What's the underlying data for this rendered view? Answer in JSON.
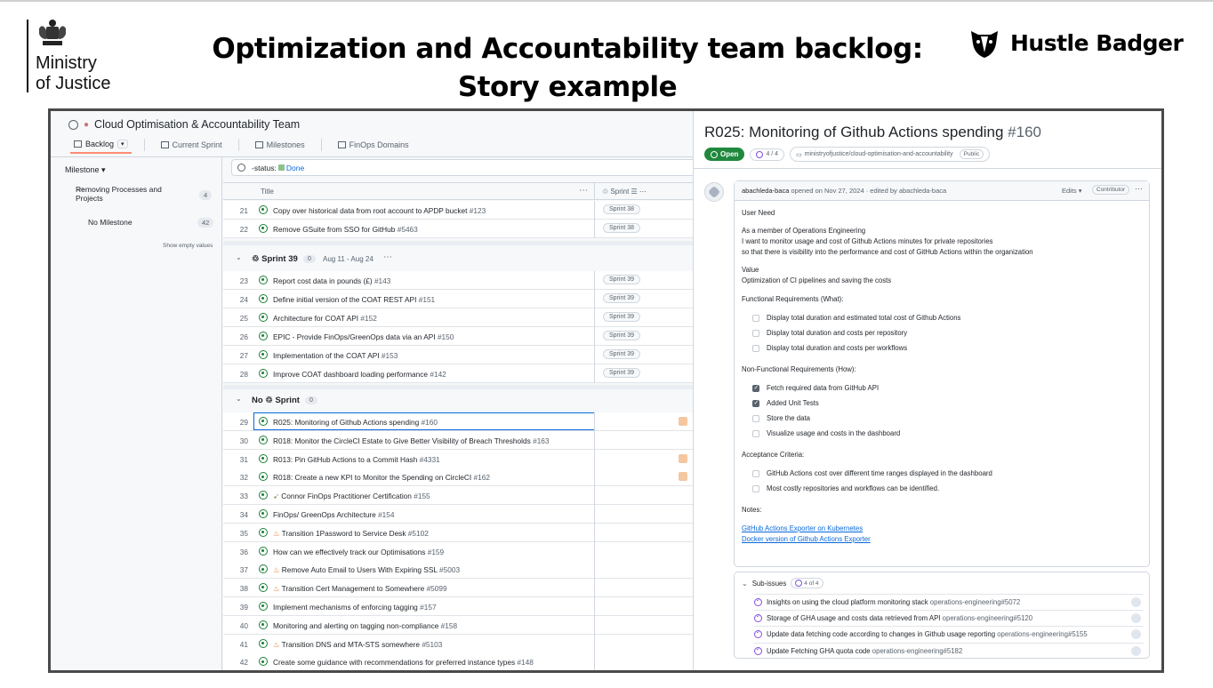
{
  "slide": {
    "title_line1": "Optimization and Accountability team backlog:",
    "title_line2": "Story example",
    "moj_line1": "Ministry",
    "moj_line2": "of Justice",
    "brand": "Hustle Badger"
  },
  "project": {
    "title": "Cloud Optimisation & Accountability Team",
    "tabs": [
      {
        "label": "Backlog",
        "active": true
      },
      {
        "label": "Current Sprint"
      },
      {
        "label": "Milestones"
      },
      {
        "label": "FinOps Domains"
      }
    ],
    "sidebar": {
      "header": "Milestone",
      "items": [
        {
          "label_line1": "Removing Processes and",
          "label_line2": "Projects",
          "count": "4"
        },
        {
          "label_line1": "No Milestone",
          "label_line2": "",
          "count": "42"
        }
      ],
      "show_empty": "Show empty values"
    },
    "filter": {
      "prefix": "-status:",
      "value": "Done"
    },
    "columns": {
      "title": "Title",
      "sprint": "Sprint"
    },
    "rows_top": [
      {
        "num": "21",
        "title": "Copy over historical data from root account to APDP bucket",
        "ref": "#123",
        "sprint": "Sprint 38"
      },
      {
        "num": "22",
        "title": "Remove GSuite from SSO for GitHub",
        "ref": "#5463",
        "sprint": "Sprint 38"
      }
    ],
    "group_sprint39": {
      "name": "Sprint 39",
      "count": "0",
      "dates": "Aug 11 - Aug 24"
    },
    "rows_sprint39": [
      {
        "num": "23",
        "title": "Report cost data in pounds (£)",
        "ref": "#143",
        "sprint": "Sprint 39"
      },
      {
        "num": "24",
        "title": "Define initial version of the COAT REST API",
        "ref": "#151",
        "sprint": "Sprint 39"
      },
      {
        "num": "25",
        "title": "Architecture for COAT API",
        "ref": "#152",
        "sprint": "Sprint 39"
      },
      {
        "num": "26",
        "title": "EPIC - Provide FinOps/GreenOps data via an API",
        "ref": "#150",
        "sprint": "Sprint 39"
      },
      {
        "num": "27",
        "title": "Implementation of the COAT API",
        "ref": "#153",
        "sprint": "Sprint 39"
      },
      {
        "num": "28",
        "title": "Improve COAT dashboard loading performance",
        "ref": "#142",
        "sprint": "Sprint 39"
      }
    ],
    "group_nosprint": {
      "name": "No",
      "name2": "Sprint",
      "count": "0"
    },
    "rows_nosprint": [
      {
        "num": "29",
        "title": "R025: Monitoring of Github Actions spending",
        "ref": "#160"
      },
      {
        "num": "30",
        "title": "R018: Monitor the CircleCI Estate to Give Better Visibility of Breach Thresholds",
        "ref": "#163"
      },
      {
        "num": "31",
        "title": "R013: Pin GitHub Actions to a Commit Hash",
        "ref": "#4331"
      },
      {
        "num": "32",
        "title": "R018: Create a new KPI to Monitor the Spending on CircleCI",
        "ref": "#162"
      },
      {
        "num": "33",
        "title": "Connor FinOps Practitioner Certification",
        "ref": "#155"
      },
      {
        "num": "34",
        "title": "FinOps/ GreenOps Architecture",
        "ref": "#154"
      },
      {
        "num": "35",
        "title": "Transition 1Password to Service Desk",
        "ref": "#5102"
      },
      {
        "num": "36",
        "title": "How can we effectively track our Optimisations",
        "ref": "#159"
      },
      {
        "num": "37",
        "title": "Remove Auto Email to Users With Expiring SSL",
        "ref": "#5003"
      },
      {
        "num": "38",
        "title": "Transition Cert Management to Somewhere",
        "ref": "#5099"
      },
      {
        "num": "39",
        "title": "Implement mechanisms of enforcing tagging",
        "ref": "#157"
      },
      {
        "num": "40",
        "title": "Monitoring and alerting on tagging non-compliance",
        "ref": "#158"
      },
      {
        "num": "41",
        "title": "Transition DNS and MTA-STS somewhere",
        "ref": "#5103"
      },
      {
        "num": "42",
        "title": "Create some guidance with recommendations for preferred instance types",
        "ref": "#148"
      }
    ]
  },
  "issue": {
    "title": "R025: Monitoring of Github Actions spending",
    "number": "#160",
    "status": "Open",
    "subissue_progress": "4 / 4",
    "repo": "ministryofjustice/cloud-optimisation-and-accountability",
    "visibility": "Public",
    "author": "abachleda-baca",
    "meta": "opened on Nov 27, 2024 · edited by abachleda-baca",
    "edits": "Edits",
    "role": "Contributor",
    "body": {
      "h_user_need": "User Need",
      "user_need_1": "As a member of Operations Engineering",
      "user_need_2": "I want to monitor usage and cost of Github Actions minutes for private repositories",
      "user_need_3": "so that there is visibility into the performance and cost of GitHub Actions within the organization",
      "h_value": "Value",
      "value": "Optimization of CI pipelines and saving the costs",
      "h_functional": "Functional Requirements (What):",
      "functional": [
        {
          "text": "Display total duration and estimated total cost of Github Actions",
          "checked": false
        },
        {
          "text": "Display total duration and costs per repository",
          "checked": false
        },
        {
          "text": "Display total duration and costs per workflows",
          "checked": false
        }
      ],
      "h_nonfunctional": "Non-Functional Requirements (How):",
      "nonfunctional": [
        {
          "text": "Fetch required data from GitHub API",
          "checked": true
        },
        {
          "text": "Added Unit Tests",
          "checked": true
        },
        {
          "text": "Store the data",
          "checked": false
        },
        {
          "text": "Visualize usage and costs in the dashboard",
          "checked": false
        }
      ],
      "h_acceptance": "Acceptance Criteria:",
      "acceptance": [
        {
          "text": "GitHub Actions cost over different time ranges displayed in the dashboard",
          "checked": false
        },
        {
          "text": "Most costly repositories and workflows can be identified.",
          "checked": false
        }
      ],
      "h_notes": "Notes:",
      "note_link_1": "GitHub Actions Exporter on Kubernetes",
      "note_link_2": "Docker version of Github Actions Exporter"
    },
    "subissues": {
      "label": "Sub-issues",
      "progress": "4 of 4",
      "items": [
        {
          "title": "Insights on using the cloud platform monitoring stack",
          "repo": "operations-engineering#5072"
        },
        {
          "title": "Storage of GHA usage and costs data retrieved from API",
          "repo": "operations-engineering#5120"
        },
        {
          "title": "Update data fetching code according to changes in Github usage reporting",
          "repo": "operations-engineering#5155"
        },
        {
          "title": "Update Fetching GHA quota code",
          "repo": "operations-engineering#5182"
        }
      ]
    }
  }
}
